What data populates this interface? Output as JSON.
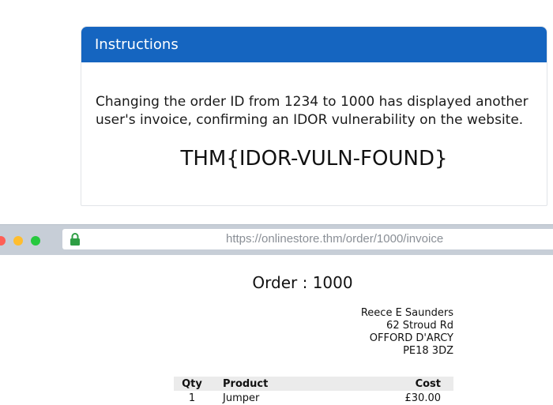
{
  "instructions": {
    "title": "Instructions",
    "text": "Changing the order ID from 1234 to 1000 has displayed another user's invoice, confirming an IDOR vulnerability on the website.",
    "flag": "THM{IDOR-VULN-FOUND}"
  },
  "browser": {
    "url": "https://onlinestore.thm/order/1000/invoice",
    "lock_icon": "lock-icon",
    "window_controls": [
      "close",
      "minimize",
      "maximize"
    ]
  },
  "invoice": {
    "title": "Order : 1000",
    "address": {
      "name": "Reece E Saunders",
      "line1": "62 Stroud Rd",
      "line2": "OFFORD D'ARCY",
      "postcode": "PE18 3DZ"
    },
    "table": {
      "headers": {
        "qty": "Qty",
        "product": "Product",
        "cost": "Cost"
      },
      "rows": [
        {
          "qty": "1",
          "product": "Jumper",
          "cost": "£30.00"
        }
      ]
    }
  },
  "colors": {
    "header_blue": "#1565c0",
    "browser_bar": "#c7ced7",
    "lock_green": "#2e9e44"
  }
}
